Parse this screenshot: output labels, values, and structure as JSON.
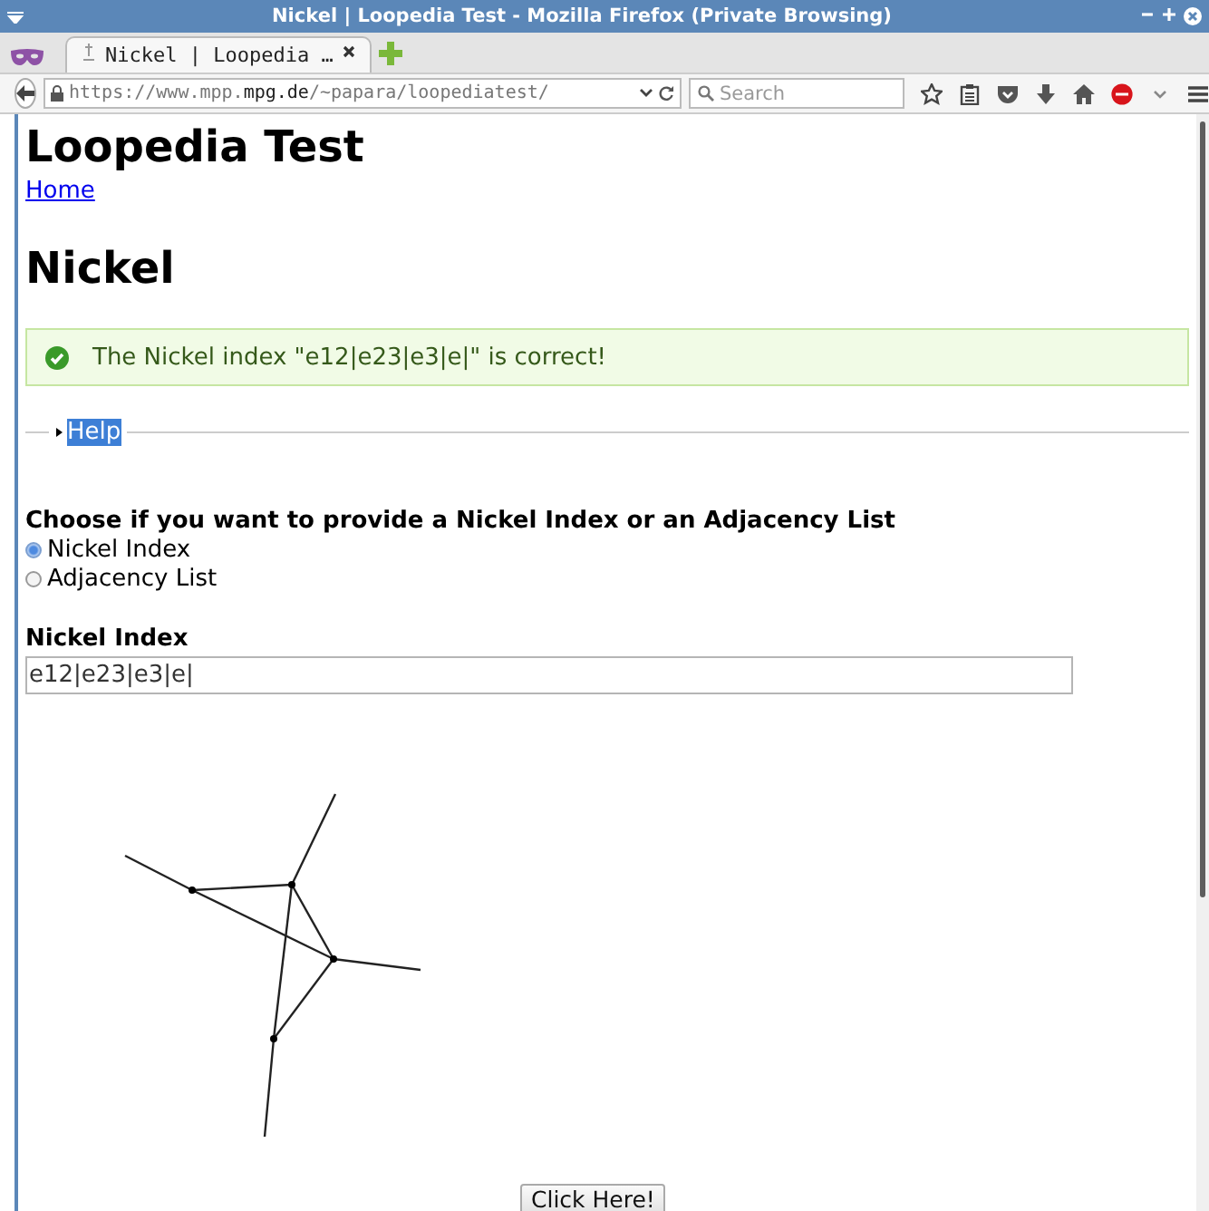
{
  "window": {
    "title": "Nickel | Loopedia Test - Mozilla Firefox (Private Browsing)"
  },
  "browser": {
    "tabs": [
      {
        "label": "Nickel | Loopedia …",
        "selected": true
      }
    ],
    "url": "https://www.mpp.**mpg.de**/~papara/loopediatest/",
    "search": {
      "placeholder": "Search"
    }
  },
  "page": {
    "site_title": "Loopedia Test",
    "nav_link": "Home",
    "heading": "Nickel",
    "alert": {
      "kind": "success",
      "message": "The Nickel index \"e12|e23|e3|e|\" is correct!"
    },
    "help": {
      "label": "Help",
      "expanded": false
    },
    "choice": {
      "prompt": "Choose if you want to provide a Nickel Index or an Adjacency List",
      "options": [
        {
          "label": "Nickel Index",
          "selected": true
        },
        {
          "label": "Adjacency List",
          "selected": false
        }
      ]
    },
    "field": {
      "label": "Nickel Index",
      "value": "e12|e23|e3|e|"
    },
    "button": "Click Here!"
  }
}
